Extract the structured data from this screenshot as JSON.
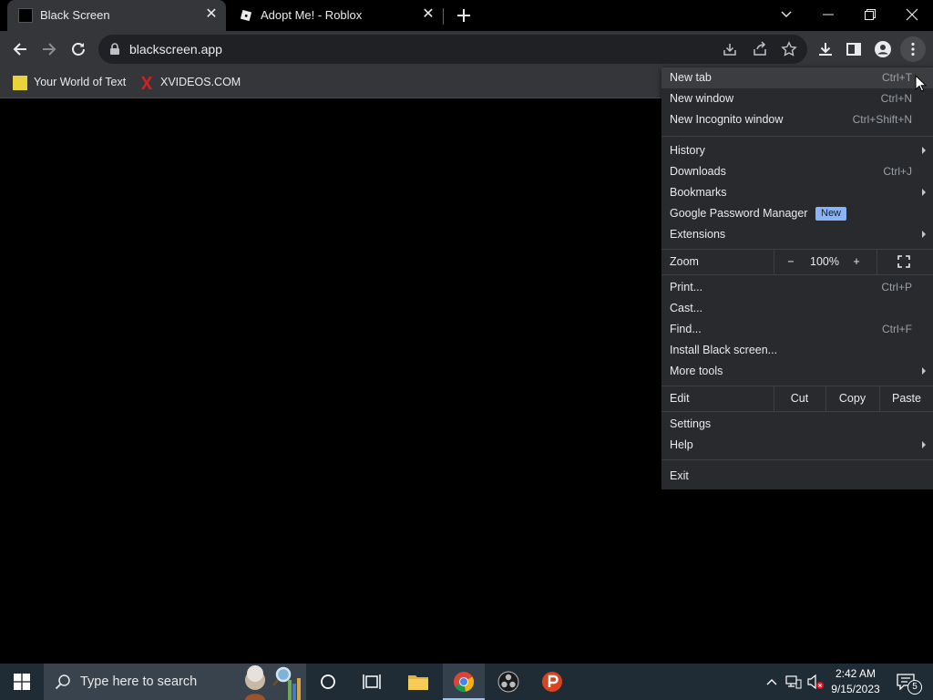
{
  "tabs": [
    {
      "title": "Black Screen",
      "active": true
    },
    {
      "title": "Adopt Me! - Roblox",
      "active": false
    }
  ],
  "toolbar": {
    "url": "blackscreen.app"
  },
  "bookmarks": [
    {
      "label": "Your World of Text"
    },
    {
      "label": "XVIDEOS.COM"
    }
  ],
  "menu": {
    "new_tab": {
      "label": "New tab",
      "shortcut": "Ctrl+T"
    },
    "new_window": {
      "label": "New window",
      "shortcut": "Ctrl+N"
    },
    "new_incognito": {
      "label": "New Incognito window",
      "shortcut": "Ctrl+Shift+N"
    },
    "history": {
      "label": "History"
    },
    "downloads": {
      "label": "Downloads",
      "shortcut": "Ctrl+J"
    },
    "bookmarks": {
      "label": "Bookmarks"
    },
    "password_manager": {
      "label": "Google Password Manager",
      "badge": "New"
    },
    "extensions": {
      "label": "Extensions"
    },
    "zoom": {
      "label": "Zoom",
      "minus": "−",
      "value": "100%",
      "plus": "+"
    },
    "print": {
      "label": "Print...",
      "shortcut": "Ctrl+P"
    },
    "cast": {
      "label": "Cast..."
    },
    "find": {
      "label": "Find...",
      "shortcut": "Ctrl+F"
    },
    "install": {
      "label": "Install Black screen..."
    },
    "more_tools": {
      "label": "More tools"
    },
    "edit": {
      "label": "Edit",
      "cut": "Cut",
      "copy": "Copy",
      "paste": "Paste"
    },
    "settings": {
      "label": "Settings"
    },
    "help": {
      "label": "Help"
    },
    "exit": {
      "label": "Exit"
    }
  },
  "taskbar": {
    "search_placeholder": "Type here to search",
    "time": "2:42 AM",
    "date": "9/15/2023",
    "notification_count": "5"
  },
  "colors": {
    "tab_active": "#35363a",
    "menu_bg": "#292a2d",
    "badge": "#8ab4f8",
    "taskbar": "#1f2b35"
  }
}
